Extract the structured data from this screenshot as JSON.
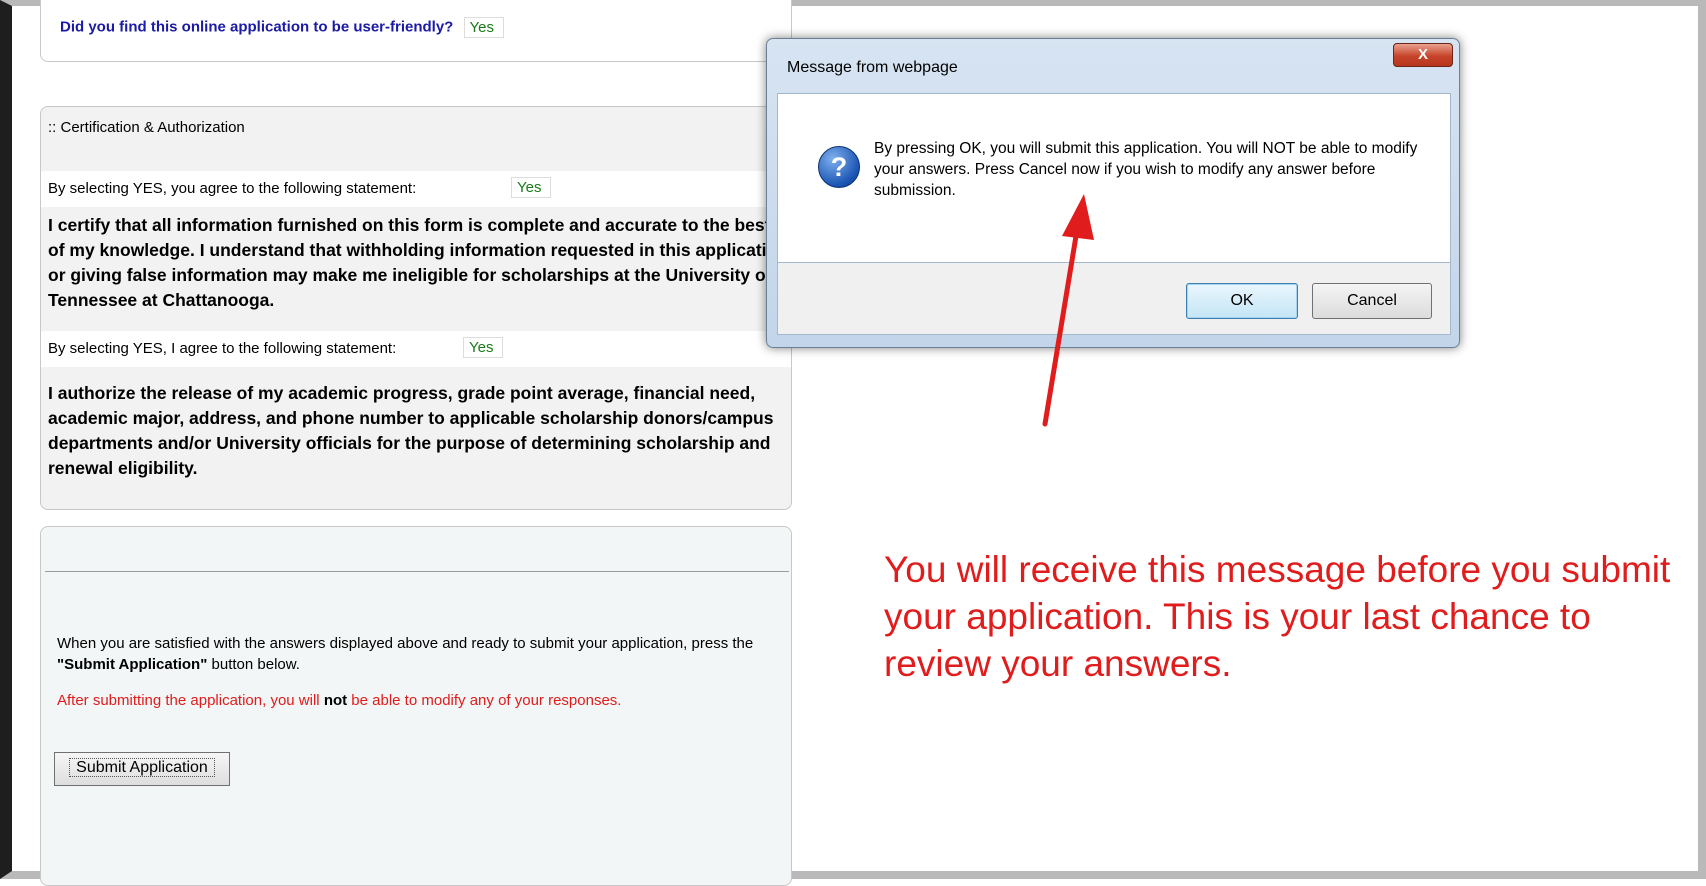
{
  "feedback": {
    "question": "Did you find this online application to be user-friendly?",
    "answer": "Yes"
  },
  "certification": {
    "header": ":: Certification & Authorization",
    "statement1_prompt": "By selecting YES, you agree to the following statement:",
    "statement1_answer": "Yes",
    "statement1_text": "I certify that all information furnished on this form is complete and accurate to the best of my knowledge. I understand that withholding information requested in this application or giving false information may make me ineligible for scholarships at the University of Tennessee at Chattanooga.",
    "statement2_prompt": "By selecting YES, I agree to the following statement:",
    "statement2_answer": "Yes",
    "statement2_text": "I authorize the release of my academic progress, grade point average, financial need, academic major, address, and phone number to applicable scholarship donors/campus departments and/or University officials for the purpose of determining scholarship and renewal eligibility."
  },
  "submit_section": {
    "instructions_pre": "When you are satisfied with the answers displayed above and ready to submit your application, press the ",
    "instructions_bold": "\"Submit Application\"",
    "instructions_post": " button below.",
    "warning_pre": "After submitting the application, you will ",
    "warning_bold": "not",
    "warning_post": " be able to modify any of your responses.",
    "button_label": "Submit Application"
  },
  "dialog": {
    "title": "Message from webpage",
    "close_label": "X",
    "icon": "question-icon",
    "message": "By pressing OK, you will submit this application.  You will NOT be able to modify your answers.  Press Cancel now if you wish to modify any answer before submission.",
    "ok_label": "OK",
    "cancel_label": "Cancel"
  },
  "annotation": {
    "text": "You will receive this message before you submit your application. This is your last chance to review your answers.",
    "color": "#e01c1c"
  },
  "colors": {
    "question_text": "#1a1aa6",
    "yes_text": "#1a7a1a",
    "warning_text": "#e01c1c",
    "section_bg": "#f2f2f2"
  }
}
